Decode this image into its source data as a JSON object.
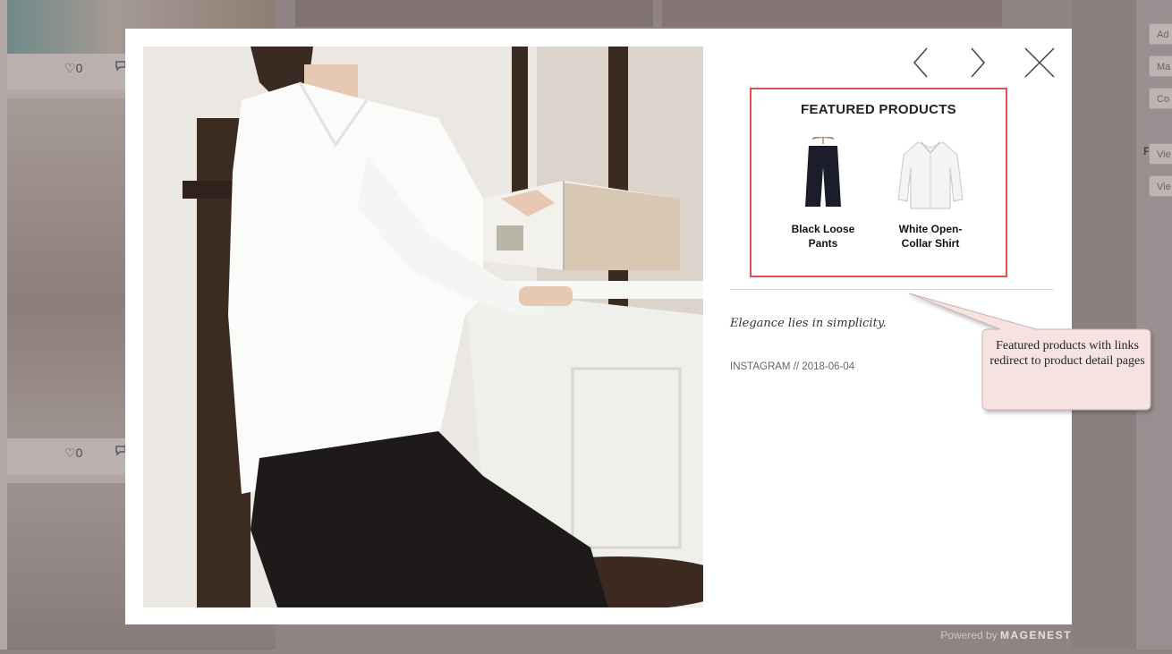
{
  "background": {
    "like_count_1": "0",
    "like_count_2": "0",
    "sidebar_buttons": [
      "Ad",
      "Ma",
      "Co",
      "Vie",
      "Vie"
    ],
    "sidebar_label": "FRON",
    "powered_prefix": "Powered by",
    "powered_brand": "MAGENEST"
  },
  "modal": {
    "featured_title": "FEATURED PRODUCTS",
    "products": [
      {
        "name": "Black Loose Pants"
      },
      {
        "name": "White Open-Collar Shirt"
      }
    ],
    "caption": "Elegance lies in simplicity.",
    "source": "INSTAGRAM // 2018-06-04"
  },
  "callout": {
    "text": "Featured products with links redirect to product detail pages"
  },
  "colors": {
    "highlight_border": "#e0504f",
    "callout_fill": "#f6e3e1"
  }
}
